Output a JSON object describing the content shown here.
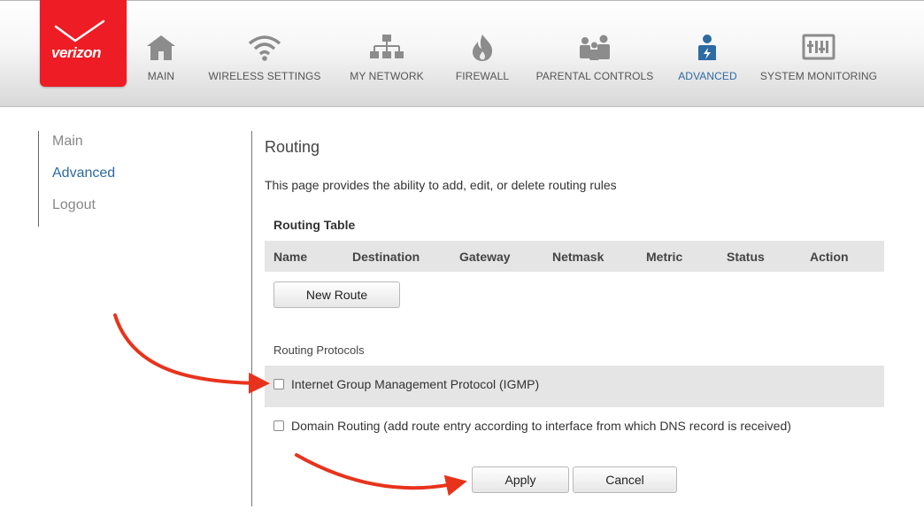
{
  "logo": {
    "text": "verizon"
  },
  "nav": [
    {
      "id": "main",
      "label": "MAIN",
      "icon": "home-icon",
      "active": false
    },
    {
      "id": "wireless",
      "label": "WIRELESS SETTINGS",
      "icon": "wifi-icon",
      "active": false
    },
    {
      "id": "network",
      "label": "MY NETWORK",
      "icon": "network-icon",
      "active": false
    },
    {
      "id": "firewall",
      "label": "FIREWALL",
      "icon": "flame-icon",
      "active": false
    },
    {
      "id": "parental",
      "label": "PARENTAL CONTROLS",
      "icon": "family-icon",
      "active": false
    },
    {
      "id": "advanced",
      "label": "ADVANCED",
      "icon": "advanced-user-icon",
      "active": true
    },
    {
      "id": "monitoring",
      "label": "SYSTEM MONITORING",
      "icon": "monitor-icon",
      "active": false
    }
  ],
  "sidebar": {
    "items": [
      {
        "label": "Main",
        "active": false
      },
      {
        "label": "Advanced",
        "active": true
      },
      {
        "label": "Logout",
        "active": false
      }
    ]
  },
  "page": {
    "title": "Routing",
    "description": "This page provides the ability to add, edit, or delete routing rules"
  },
  "routing_table": {
    "title": "Routing Table",
    "columns": [
      "Name",
      "Destination",
      "Gateway",
      "Netmask",
      "Metric",
      "Status",
      "Action"
    ],
    "rows": [],
    "new_route_label": "New Route"
  },
  "routing_protocols": {
    "title": "Routing Protocols",
    "items": [
      {
        "label": "Internet Group Management Protocol (IGMP)",
        "checked": false
      },
      {
        "label": "Domain Routing (add route entry according to interface from which DNS record is received)",
        "checked": false
      }
    ]
  },
  "actions": {
    "apply_label": "Apply",
    "cancel_label": "Cancel"
  },
  "colors": {
    "brand_red": "#ee1c24",
    "active_blue": "#2e6aa3",
    "annotation_arrow": "#e8331c"
  }
}
